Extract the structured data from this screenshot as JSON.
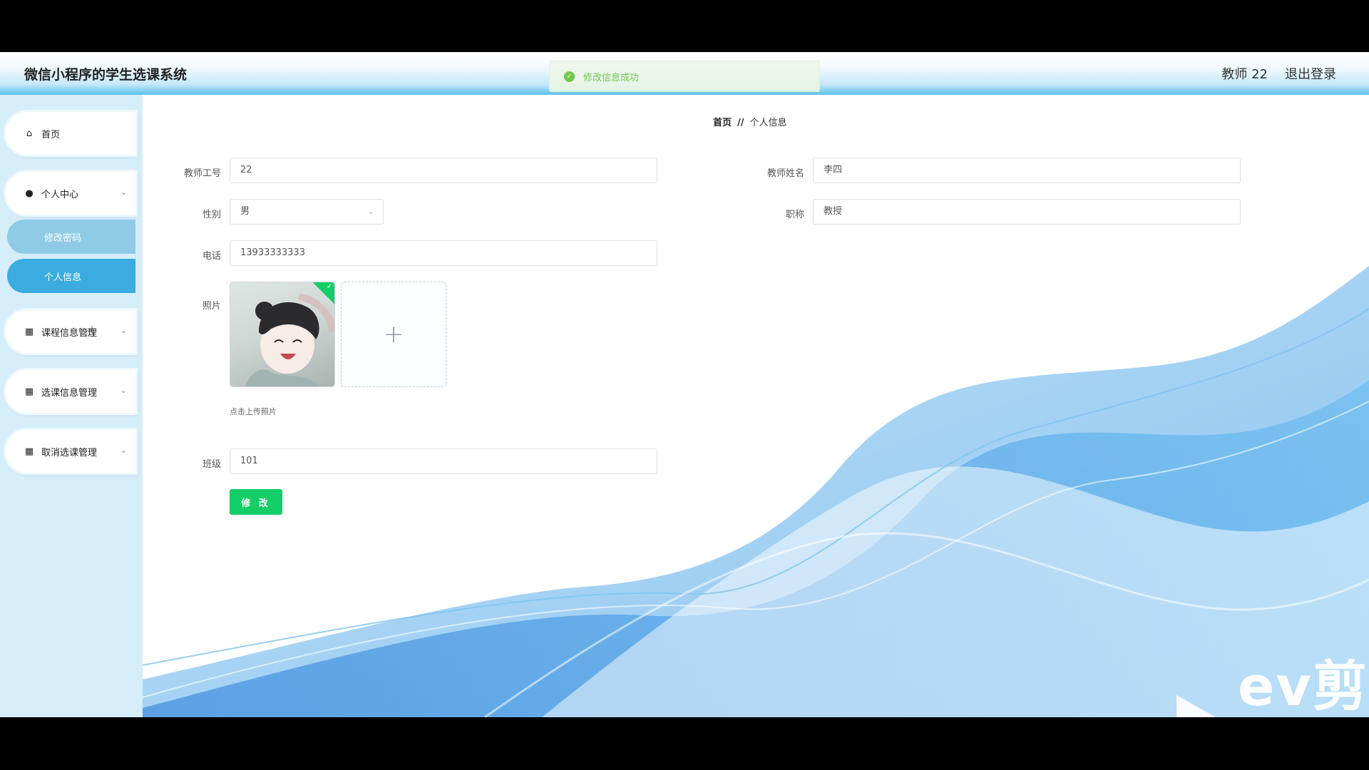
{
  "header": {
    "app_title": "微信小程序的学生选课系统",
    "user_label": "教师 22",
    "logout_label": "退出登录"
  },
  "toast": {
    "message": "修改信息成功",
    "color": "#67c23a"
  },
  "sidebar": {
    "items": [
      {
        "label": "首页",
        "icon": "home-icon"
      },
      {
        "label": "个人中心",
        "icon": "user-icon",
        "expanded": true,
        "children": [
          {
            "label": "修改密码",
            "active": false
          },
          {
            "label": "个人信息",
            "active": true
          }
        ]
      },
      {
        "label": "课程信息管理",
        "icon": "grid-icon"
      },
      {
        "label": "选课信息管理",
        "icon": "grid-icon"
      },
      {
        "label": "取消选课管理",
        "icon": "grid-icon"
      }
    ]
  },
  "breadcrumb": {
    "home": "首页",
    "separator": "//",
    "current": "个人信息"
  },
  "form": {
    "teacher_id": {
      "label": "教师工号",
      "value": "22"
    },
    "teacher_name": {
      "label": "教师姓名",
      "value": "李四"
    },
    "gender": {
      "label": "性别",
      "value": "男"
    },
    "title": {
      "label": "职称",
      "value": "教授"
    },
    "phone": {
      "label": "电话",
      "value": "13933333333"
    },
    "photo": {
      "label": "照片",
      "tip": "点击上传照片"
    },
    "class": {
      "label": "班级",
      "value": "101"
    },
    "submit_label": "修 改"
  },
  "watermark": {
    "text": "ev剪辑"
  },
  "colors": {
    "accent": "#3aace0",
    "submit": "#13ce66",
    "sidebar_bg": "#d6eef9"
  }
}
